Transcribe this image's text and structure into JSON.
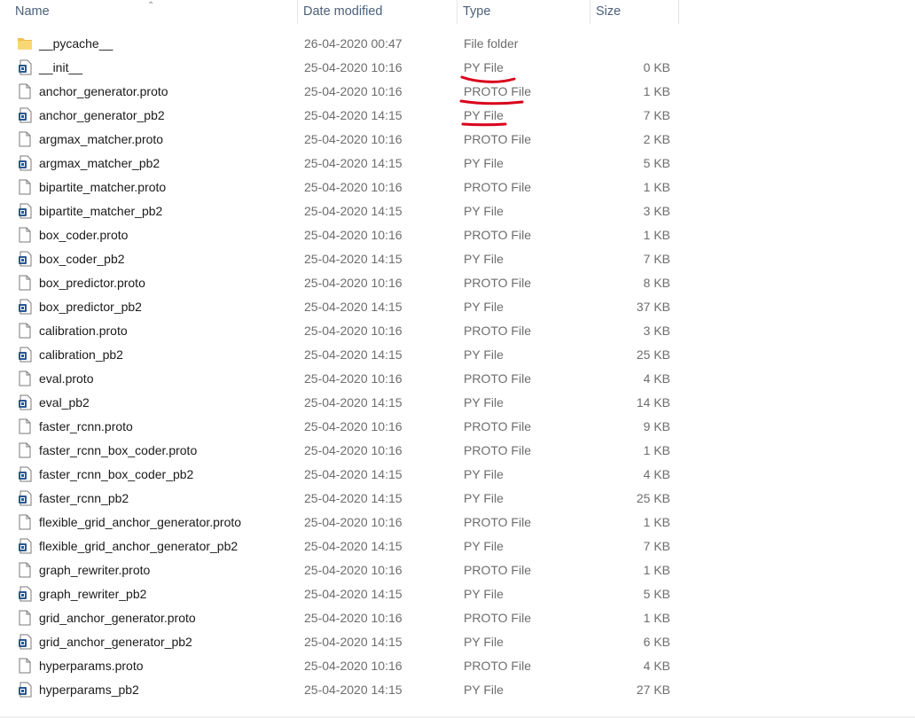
{
  "columns": {
    "name": "Name",
    "date": "Date modified",
    "type": "Type",
    "size": "Size"
  },
  "rows": [
    {
      "icon": "folder-icon",
      "name": "__pycache__",
      "date": "26-04-2020 00:47",
      "type": "File folder",
      "size": ""
    },
    {
      "icon": "py-file-icon",
      "name": "__init__",
      "date": "25-04-2020 10:16",
      "type": "PY File",
      "size": "0 KB"
    },
    {
      "icon": "blank-file-icon",
      "name": "anchor_generator.proto",
      "date": "25-04-2020 10:16",
      "type": "PROTO File",
      "size": "1 KB"
    },
    {
      "icon": "py-file-icon",
      "name": "anchor_generator_pb2",
      "date": "25-04-2020 14:15",
      "type": "PY File",
      "size": "7 KB"
    },
    {
      "icon": "blank-file-icon",
      "name": "argmax_matcher.proto",
      "date": "25-04-2020 10:16",
      "type": "PROTO File",
      "size": "2 KB"
    },
    {
      "icon": "py-file-icon",
      "name": "argmax_matcher_pb2",
      "date": "25-04-2020 14:15",
      "type": "PY File",
      "size": "5 KB"
    },
    {
      "icon": "blank-file-icon",
      "name": "bipartite_matcher.proto",
      "date": "25-04-2020 10:16",
      "type": "PROTO File",
      "size": "1 KB"
    },
    {
      "icon": "py-file-icon",
      "name": "bipartite_matcher_pb2",
      "date": "25-04-2020 14:15",
      "type": "PY File",
      "size": "3 KB"
    },
    {
      "icon": "blank-file-icon",
      "name": "box_coder.proto",
      "date": "25-04-2020 10:16",
      "type": "PROTO File",
      "size": "1 KB"
    },
    {
      "icon": "py-file-icon",
      "name": "box_coder_pb2",
      "date": "25-04-2020 14:15",
      "type": "PY File",
      "size": "7 KB"
    },
    {
      "icon": "blank-file-icon",
      "name": "box_predictor.proto",
      "date": "25-04-2020 10:16",
      "type": "PROTO File",
      "size": "8 KB"
    },
    {
      "icon": "py-file-icon",
      "name": "box_predictor_pb2",
      "date": "25-04-2020 14:15",
      "type": "PY File",
      "size": "37 KB"
    },
    {
      "icon": "blank-file-icon",
      "name": "calibration.proto",
      "date": "25-04-2020 10:16",
      "type": "PROTO File",
      "size": "3 KB"
    },
    {
      "icon": "py-file-icon",
      "name": "calibration_pb2",
      "date": "25-04-2020 14:15",
      "type": "PY File",
      "size": "25 KB"
    },
    {
      "icon": "blank-file-icon",
      "name": "eval.proto",
      "date": "25-04-2020 10:16",
      "type": "PROTO File",
      "size": "4 KB"
    },
    {
      "icon": "py-file-icon",
      "name": "eval_pb2",
      "date": "25-04-2020 14:15",
      "type": "PY File",
      "size": "14 KB"
    },
    {
      "icon": "blank-file-icon",
      "name": "faster_rcnn.proto",
      "date": "25-04-2020 10:16",
      "type": "PROTO File",
      "size": "9 KB"
    },
    {
      "icon": "blank-file-icon",
      "name": "faster_rcnn_box_coder.proto",
      "date": "25-04-2020 10:16",
      "type": "PROTO File",
      "size": "1 KB"
    },
    {
      "icon": "py-file-icon",
      "name": "faster_rcnn_box_coder_pb2",
      "date": "25-04-2020 14:15",
      "type": "PY File",
      "size": "4 KB"
    },
    {
      "icon": "py-file-icon",
      "name": "faster_rcnn_pb2",
      "date": "25-04-2020 14:15",
      "type": "PY File",
      "size": "25 KB"
    },
    {
      "icon": "blank-file-icon",
      "name": "flexible_grid_anchor_generator.proto",
      "date": "25-04-2020 10:16",
      "type": "PROTO File",
      "size": "1 KB"
    },
    {
      "icon": "py-file-icon",
      "name": "flexible_grid_anchor_generator_pb2",
      "date": "25-04-2020 14:15",
      "type": "PY File",
      "size": "7 KB"
    },
    {
      "icon": "blank-file-icon",
      "name": "graph_rewriter.proto",
      "date": "25-04-2020 10:16",
      "type": "PROTO File",
      "size": "1 KB"
    },
    {
      "icon": "py-file-icon",
      "name": "graph_rewriter_pb2",
      "date": "25-04-2020 14:15",
      "type": "PY File",
      "size": "5 KB"
    },
    {
      "icon": "blank-file-icon",
      "name": "grid_anchor_generator.proto",
      "date": "25-04-2020 10:16",
      "type": "PROTO File",
      "size": "1 KB"
    },
    {
      "icon": "py-file-icon",
      "name": "grid_anchor_generator_pb2",
      "date": "25-04-2020 14:15",
      "type": "PY File",
      "size": "6 KB"
    },
    {
      "icon": "blank-file-icon",
      "name": "hyperparams.proto",
      "date": "25-04-2020 10:16",
      "type": "PROTO File",
      "size": "4 KB"
    },
    {
      "icon": "py-file-icon",
      "name": "hyperparams_pb2",
      "date": "25-04-2020 14:15",
      "type": "PY File",
      "size": "27 KB"
    }
  ],
  "annotation": {
    "color": "#d9001b"
  }
}
